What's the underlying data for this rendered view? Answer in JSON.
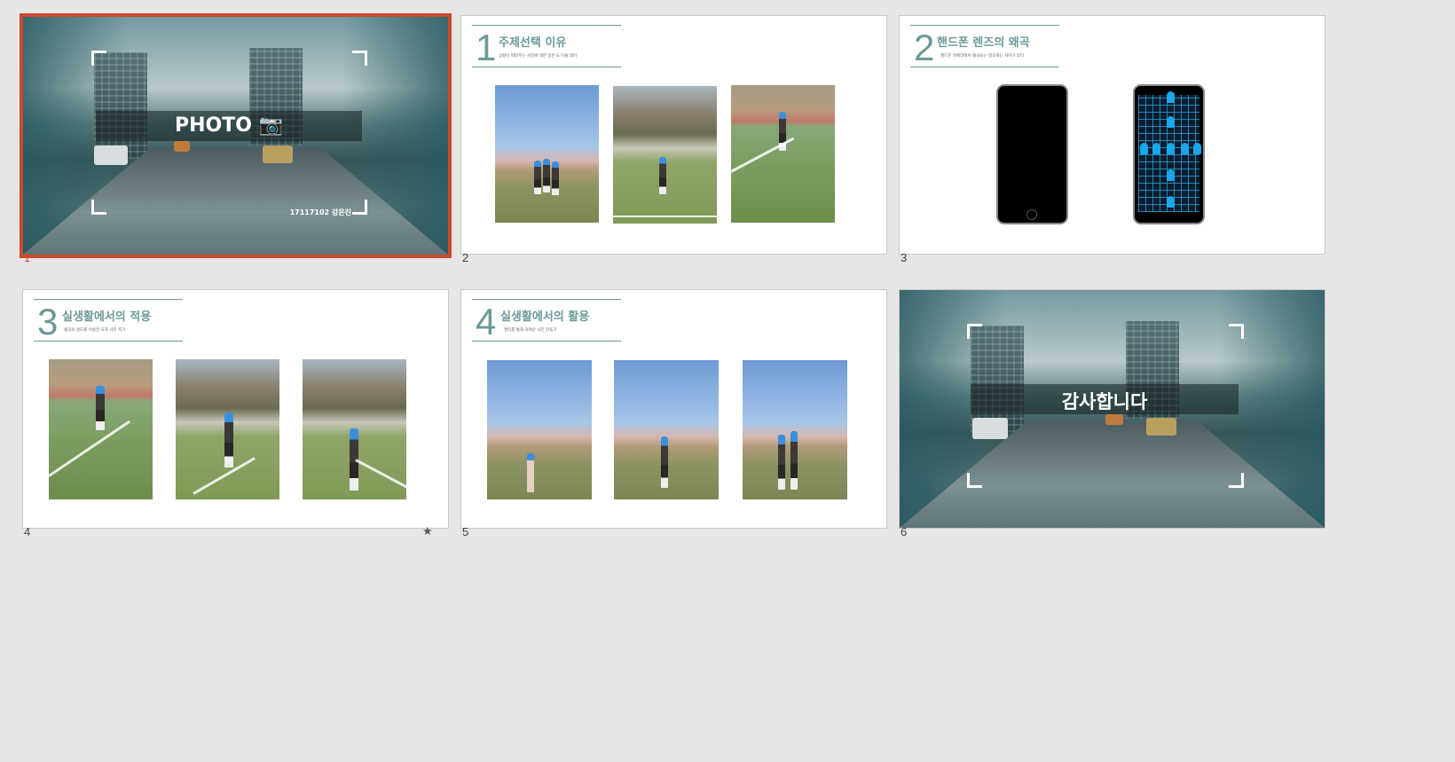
{
  "slides": [
    {
      "number": "1",
      "title": "PHOTO 📷",
      "author": "17117102 강은진",
      "selected": true
    },
    {
      "number": "2",
      "heading_num": "1",
      "heading": "주제선택 이유",
      "subtitle": "상황이 떠따주는 사진에 대한 동반 & 이울 데이"
    },
    {
      "number": "3",
      "heading_num": "2",
      "heading": "핸드폰 렌즈의 왜곡",
      "subtitle": "핸드폰 카메라에서 왜곡되는 정도에는 차이가 있다"
    },
    {
      "number": "4",
      "heading_num": "3",
      "heading": "실생활에서의 적용",
      "subtitle": "왜곡의 정도를 이용한 효과 사진 찍기",
      "has_animation": true,
      "animation_marker": "★"
    },
    {
      "number": "5",
      "heading_num": "4",
      "heading": "실생활에서의 활용",
      "subtitle": "멀티를 통해 귀여운 사진 만들기"
    },
    {
      "number": "6",
      "title": "감사합니다"
    }
  ],
  "colors": {
    "accent": "#6b9a9a",
    "selection": "#c94a2c",
    "background": "#e6e6e6",
    "phone_grid": "#19a6ea"
  }
}
